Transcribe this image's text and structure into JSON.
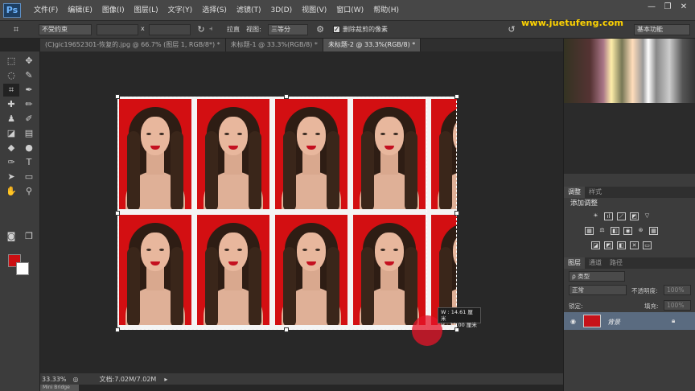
{
  "app": {
    "logo": "Ps"
  },
  "menu": [
    "文件(F)",
    "编辑(E)",
    "图像(I)",
    "图层(L)",
    "文字(Y)",
    "选择(S)",
    "滤镜(T)",
    "3D(D)",
    "视图(V)",
    "窗口(W)",
    "帮助(H)"
  ],
  "window_controls": {
    "minimize": "—",
    "restore": "❐",
    "close": "✕"
  },
  "options": {
    "ratio_select": "不受约束",
    "x_sep": "x",
    "straighten": "拉直",
    "view_label": "视图:",
    "view_select": "三等分",
    "delete_cropped": "删除裁剪的像素",
    "delete_checked": true,
    "workspace": "基本功能"
  },
  "watermark": "www.juetufeng.com",
  "doc_tabs": [
    {
      "label": "(C)gic19652301-恢复的.jpg @ 66.7% (图层 1, RGB/8*) *",
      "active": false
    },
    {
      "label": "未标题-1 @ 33.3%(RGB/8) *",
      "active": false
    },
    {
      "label": "未标题-2 @ 33.3%(RGB/8) *",
      "active": true
    }
  ],
  "tooltip": {
    "w": "W : 14.61 厘米",
    "h": "H : 11.00 厘米"
  },
  "status": {
    "zoom": "33.33%",
    "doc": "文档:7.02M/7.02M"
  },
  "bottom_tab": "Mini Bridge",
  "colors": {
    "foreground": "#cc0f12",
    "background": "#ffffff",
    "photo_bg": "#d30f12"
  },
  "panels": {
    "adjustments_tab": "调整",
    "styles_tab": "样式",
    "add_adjustment": "添加调整",
    "layers_tab": "图层",
    "channels_tab": "通道",
    "paths_tab": "路径",
    "kind_filter": "ρ 类型",
    "blend_mode": "正常",
    "opacity_label": "不透明度:",
    "opacity_value": "100%",
    "lock_label": "锁定:",
    "fill_label": "填充:",
    "fill_value": "100%",
    "layer_name": "背景"
  }
}
